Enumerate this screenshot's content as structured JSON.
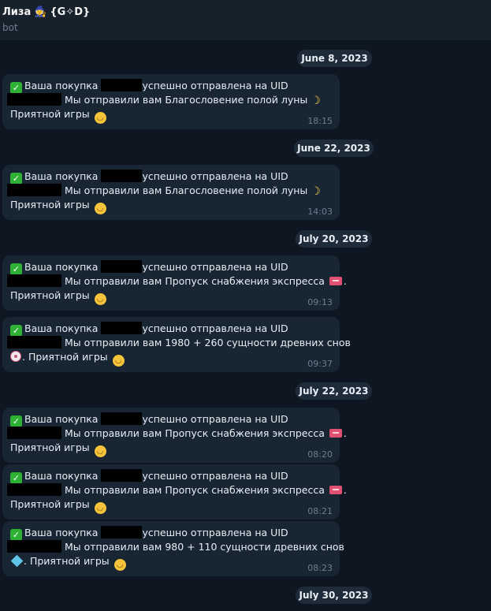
{
  "header": {
    "name": "Лиза",
    "emoji": "🧙",
    "tag": "{G✧D}",
    "subtitle": "bot"
  },
  "dates": [
    "June 8, 2023",
    "June 22, 2023",
    "July 20, 2023",
    "July 22, 2023",
    "July 30, 2023"
  ],
  "messages": [
    {
      "l1a": "Ваша покупка",
      "l1b": "успешно отправлена на UID",
      "l2": "Мы отправили вам Благословение полой луны",
      "l3": "Приятной игры",
      "time": "18:15"
    },
    {
      "l1a": "Ваша покупка",
      "l1b": "успешно отправлена на UID",
      "l2": "Мы отправили вам Благословение полой луны",
      "l3": "Приятной игры",
      "time": "14:03"
    },
    {
      "l1a": "Ваша покупка",
      "l1b": "успешно отправлена на UID",
      "l2": "Мы отправили вам Пропуск снабжения экспресса",
      "l2end": ".",
      "l3": "Приятной игры",
      "time": "09:13"
    },
    {
      "l1a": "Ваша покупка",
      "l1b": "успешно отправлена на UID",
      "l2": "Мы отправили вам 1980 + 260 сущности древних снов",
      "l3": ". Приятной игры",
      "time": "09:37"
    },
    {
      "l1a": "Ваша покупка",
      "l1b": "успешно отправлена на UID",
      "l2": "Мы отправили вам Пропуск снабжения экспресса",
      "l2end": ".",
      "l3": "Приятной игры",
      "time": "08:20"
    },
    {
      "l1a": "Ваша покупка",
      "l1b": "успешно отправлена на UID",
      "l2": "Мы отправили вам Пропуск снабжения экспресса",
      "l2end": ".",
      "l3": "Приятной игры",
      "time": "08:21"
    },
    {
      "l1a": "Ваша покупка",
      "l1b": "успешно отправлена на UID",
      "l2": "Мы отправили вам 980 + 110 сущности древних снов",
      "l3": ". Приятной игры",
      "time": "08:23"
    }
  ]
}
